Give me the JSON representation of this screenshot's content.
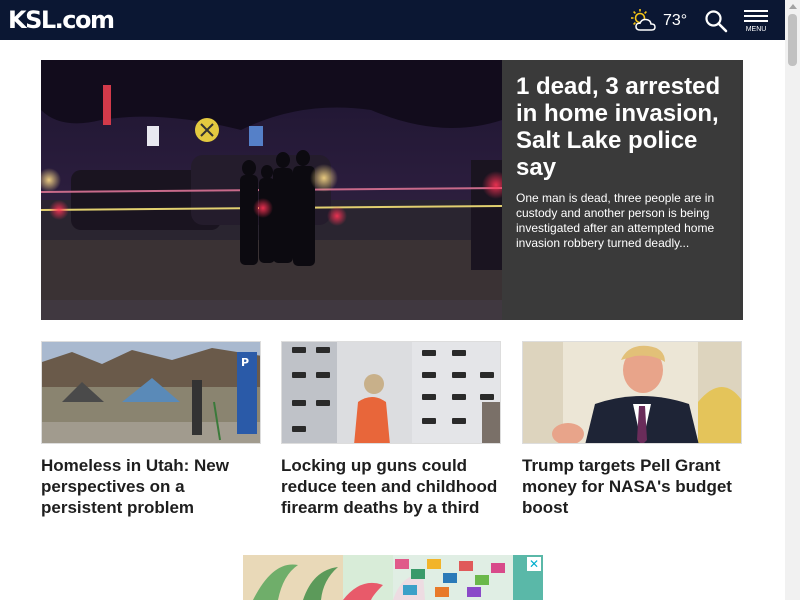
{
  "header": {
    "logo": "KSL.com",
    "weather": {
      "icon": "partly-cloudy-icon",
      "temperature": "73°"
    },
    "search": {
      "icon": "search-icon"
    },
    "menu": {
      "icon": "hamburger-icon",
      "label": "MENU"
    }
  },
  "hero": {
    "title": "1 dead, 3 arrested in home invasion, Salt Lake police say",
    "summary": "One man is dead, three people are in custody and another person is being investigated after an attempted home invasion robbery turned deadly..."
  },
  "cards": [
    {
      "headline": "Homeless in Utah: New perspectives on a persistent problem"
    },
    {
      "headline": "Locking up guns could reduce teen and childhood firearm deaths by a third"
    },
    {
      "headline": "Trump targets Pell Grant money for NASA's budget boost"
    }
  ],
  "ad": {
    "close_icon": "ad-close-icon"
  },
  "colors": {
    "header_bg": "#0b1733",
    "hero_panel_bg": "#3a3a3a",
    "ad_close": "#00aecd"
  }
}
